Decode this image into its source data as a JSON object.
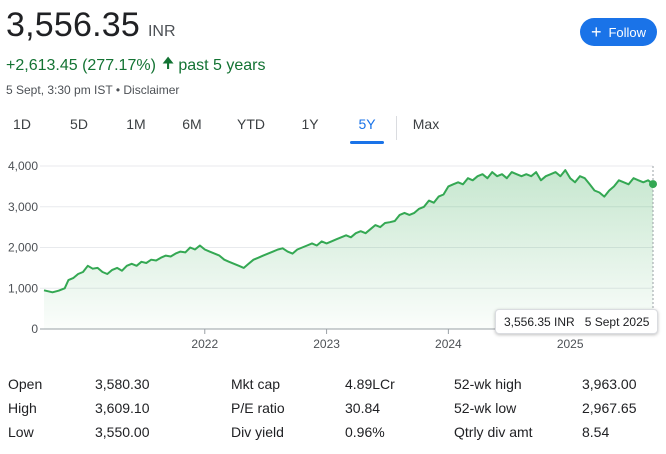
{
  "quote": {
    "price": "3,556.35",
    "currency": "INR",
    "change": "+2,613.45 (277.17%)",
    "period": "past 5 years",
    "timestamp": "5 Sept, 3:30 pm IST • Disclaimer",
    "follow_label": "Follow"
  },
  "tabs": [
    {
      "label": "1D"
    },
    {
      "label": "5D"
    },
    {
      "label": "1M"
    },
    {
      "label": "6M"
    },
    {
      "label": "YTD"
    },
    {
      "label": "1Y"
    },
    {
      "label": "5Y",
      "active": true
    },
    {
      "label": "Max"
    }
  ],
  "chart_data": {
    "type": "area",
    "y_ticks": [
      "0",
      "1,000",
      "2,000",
      "3,000",
      "4,000"
    ],
    "x_ticks": [
      "2022",
      "2023",
      "2024",
      "2025"
    ],
    "ylim": [
      0,
      4000
    ],
    "xlim": [
      2020.68,
      2025.68
    ],
    "grid": true,
    "line_color": "#34a853",
    "series": [
      {
        "x": [
          2020.68,
          2020.75,
          2020.8,
          2020.85,
          2020.88,
          2020.92,
          2020.96,
          2021.0,
          2021.04,
          2021.08,
          2021.12,
          2021.16,
          2021.2,
          2021.24,
          2021.28,
          2021.32,
          2021.36,
          2021.4,
          2021.44,
          2021.48,
          2021.52,
          2021.56,
          2021.6,
          2021.64,
          2021.68,
          2021.72,
          2021.76,
          2021.8,
          2021.84,
          2021.88,
          2021.92,
          2021.96,
          2022.0,
          2022.04,
          2022.08,
          2022.12,
          2022.16,
          2022.2,
          2022.24,
          2022.28,
          2022.32,
          2022.36,
          2022.4,
          2022.44,
          2022.48,
          2022.52,
          2022.56,
          2022.6,
          2022.64,
          2022.68,
          2022.72,
          2022.76,
          2022.8,
          2022.84,
          2022.88,
          2022.92,
          2022.96,
          2023.0,
          2023.04,
          2023.08,
          2023.12,
          2023.16,
          2023.2,
          2023.24,
          2023.28,
          2023.32,
          2023.36,
          2023.4,
          2023.44,
          2023.48,
          2023.52,
          2023.56,
          2023.6,
          2023.64,
          2023.68,
          2023.72,
          2023.76,
          2023.8,
          2023.84,
          2023.88,
          2023.92,
          2023.96,
          2024.0,
          2024.04,
          2024.08,
          2024.12,
          2024.16,
          2024.2,
          2024.24,
          2024.28,
          2024.32,
          2024.36,
          2024.4,
          2024.44,
          2024.48,
          2024.52,
          2024.56,
          2024.6,
          2024.64,
          2024.68,
          2024.72,
          2024.76,
          2024.8,
          2024.84,
          2024.88,
          2024.92,
          2024.96,
          2025.0,
          2025.04,
          2025.08,
          2025.12,
          2025.16,
          2025.2,
          2025.24,
          2025.28,
          2025.32,
          2025.36,
          2025.4,
          2025.44,
          2025.48,
          2025.52,
          2025.56,
          2025.6,
          2025.64,
          2025.68
        ],
        "y": [
          950,
          900,
          940,
          1000,
          1200,
          1250,
          1350,
          1400,
          1550,
          1480,
          1500,
          1400,
          1350,
          1450,
          1500,
          1430,
          1550,
          1600,
          1550,
          1650,
          1620,
          1700,
          1680,
          1750,
          1800,
          1780,
          1850,
          1900,
          1880,
          2000,
          1950,
          2050,
          1950,
          1900,
          1850,
          1800,
          1700,
          1650,
          1600,
          1550,
          1500,
          1600,
          1700,
          1750,
          1800,
          1850,
          1900,
          1950,
          1980,
          1900,
          1850,
          1950,
          2000,
          2050,
          2100,
          2050,
          2150,
          2100,
          2150,
          2200,
          2250,
          2300,
          2250,
          2350,
          2400,
          2350,
          2450,
          2550,
          2500,
          2600,
          2620,
          2650,
          2800,
          2850,
          2800,
          2850,
          2950,
          3000,
          3150,
          3100,
          3250,
          3300,
          3500,
          3550,
          3600,
          3550,
          3700,
          3650,
          3750,
          3800,
          3700,
          3850,
          3750,
          3800,
          3700,
          3850,
          3800,
          3750,
          3800,
          3750,
          3850,
          3650,
          3750,
          3800,
          3850,
          3750,
          3900,
          3700,
          3600,
          3750,
          3700,
          3550,
          3400,
          3350,
          3250,
          3400,
          3500,
          3650,
          3600,
          3550,
          3700,
          3650,
          3600,
          3650,
          3556.35
        ]
      }
    ],
    "tooltip": {
      "value": "3,556.35 INR",
      "date": "5 Sept 2025"
    }
  },
  "stats": [
    {
      "label": "Open",
      "value": "3,580.30"
    },
    {
      "label": "High",
      "value": "3,609.10"
    },
    {
      "label": "Low",
      "value": "3,550.00"
    },
    {
      "label": "Mkt cap",
      "value": "4.89LCr"
    },
    {
      "label": "P/E ratio",
      "value": "30.84"
    },
    {
      "label": "Div yield",
      "value": "0.96%"
    },
    {
      "label": "52-wk high",
      "value": "3,963.00"
    },
    {
      "label": "52-wk low",
      "value": "2,967.65"
    },
    {
      "label": "Qtrly div amt",
      "value": "8.54"
    }
  ]
}
